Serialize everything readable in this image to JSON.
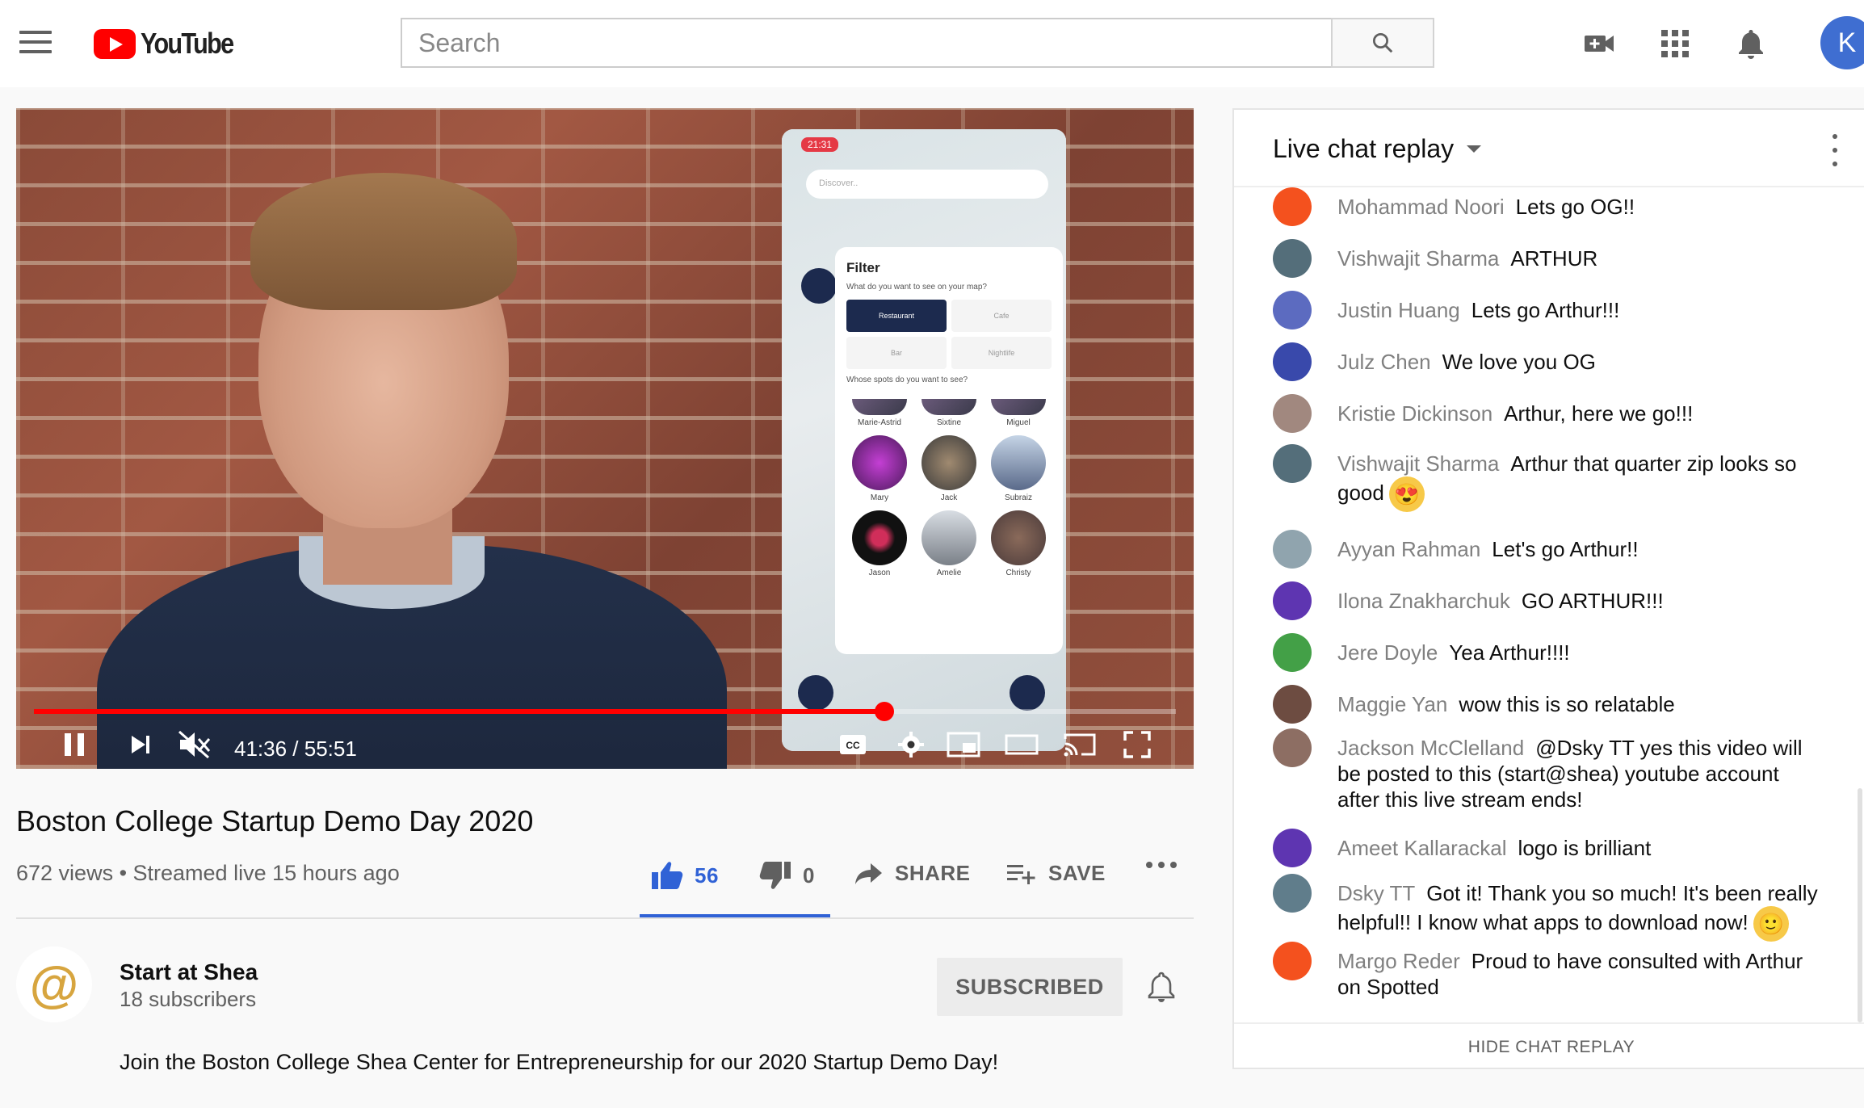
{
  "header": {
    "logo_text": "YouTube",
    "search_placeholder": "Search",
    "avatar_initial": "K"
  },
  "player": {
    "time": "41:36 / 55:51",
    "progress": 0.745,
    "phone": {
      "clock": "21:31",
      "search_placeholder": "Discover..",
      "filter_title": "Filter",
      "filter_question": "What do you want to see on your map?",
      "categories": [
        "Restaurant",
        "Cafe",
        "Bar",
        "Nightlife"
      ],
      "spots_question": "Whose spots do you want to see?",
      "friends": [
        "Marie-Astrid",
        "Sixtine",
        "Miguel",
        "Mary",
        "Jack",
        "Subraiz",
        "Jason",
        "Amelie",
        "Christy"
      ]
    }
  },
  "video": {
    "title": "Boston College Startup Demo Day 2020",
    "meta": "672 views • Streamed live 15 hours ago",
    "likes": "56",
    "dislikes": "0",
    "share_label": "SHARE",
    "save_label": "SAVE"
  },
  "channel": {
    "name": "Start at Shea",
    "subscribers": "18 subscribers",
    "subscribe_label": "SUBSCRIBED",
    "logo_glyph": "@",
    "description": "Join the Boston College Shea Center for Entrepreneurship for our 2020 Startup Demo Day!"
  },
  "chat": {
    "title": "Live chat replay",
    "footer": "HIDE CHAT REPLAY",
    "messages": [
      {
        "author": "Mohammad Noori",
        "text": "Lets go OG!!",
        "color": "#f4511e"
      },
      {
        "author": "Vishwajit Sharma",
        "text": "ARTHUR",
        "color": "#546e7a"
      },
      {
        "author": "Justin Huang",
        "text": "Lets go Arthur!!!",
        "color": "#5c6bc0"
      },
      {
        "author": "Julz Chen",
        "text": "We love you OG",
        "color": "#3949ab"
      },
      {
        "author": "Kristie Dickinson",
        "text": "Arthur, here we go!!!",
        "color": "#a1887f"
      },
      {
        "author": "Vishwajit Sharma",
        "text": "Arthur that quarter zip looks so good",
        "color": "#546e7a",
        "emoji": "😍"
      },
      {
        "author": "Ayyan Rahman",
        "text": "Let's go Arthur!!",
        "color": "#90a4ae"
      },
      {
        "author": "Ilona Znakharchuk",
        "text": "GO ARTHUR!!!",
        "color": "#5e35b1"
      },
      {
        "author": "Jere Doyle",
        "text": "Yea Arthur!!!!",
        "color": "#43a047"
      },
      {
        "author": "Maggie Yan",
        "text": "wow this is so relatable",
        "color": "#6d4c41"
      },
      {
        "author": "Jackson McClelland",
        "text": "@Dsky TT yes this video will be posted to this (start@shea) youtube account after this live stream ends!",
        "color": "#8d6e63"
      },
      {
        "author": "Ameet Kallarackal",
        "text": "logo is brilliant",
        "color": "#5e35b1"
      },
      {
        "author": "Dsky TT",
        "text": "Got it! Thank you so much! It's been really helpful!! I know what apps to download now!",
        "color": "#607d8b",
        "emoji": "🙂"
      },
      {
        "author": "Margo Reder",
        "text": "Proud to have consulted with Arthur on Spotted",
        "color": "#f4511e"
      }
    ]
  }
}
